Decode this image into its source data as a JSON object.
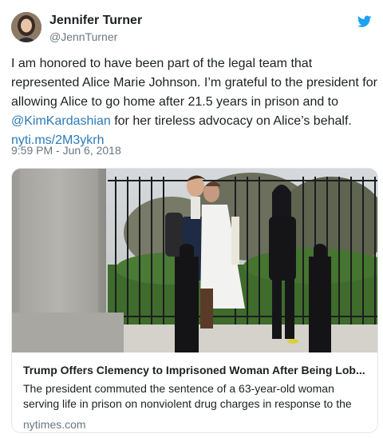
{
  "author": {
    "display_name": "Jennifer Turner",
    "handle": "@JennTurner",
    "avatar_icon": "profile-photo",
    "brand_icon": "twitter-bird-icon",
    "brand_color": "#1da1f2"
  },
  "tweet": {
    "text_before_mention": "I am honored to have been part of the legal team that represented Alice Marie Johnson. I’m grateful to the president for allowing Alice to go home after 21.5 years in prison and to ",
    "mention": "@KimKardashian",
    "text_after_mention": " for her tireless advocacy on Alice’s behalf. ",
    "link": "nyti.ms/2M3ykrh",
    "timestamp": "9:59 PM - Jun 6, 2018",
    "link_color": "#2b7bb9"
  },
  "card": {
    "title": "Trump Offers Clemency to Imprisoned Woman After Being Lob...",
    "description": "The president commuted the sentence of a 63-year-old woman serving life in prison on nonviolent drug charges in response to the",
    "domain": "nytimes.com"
  }
}
